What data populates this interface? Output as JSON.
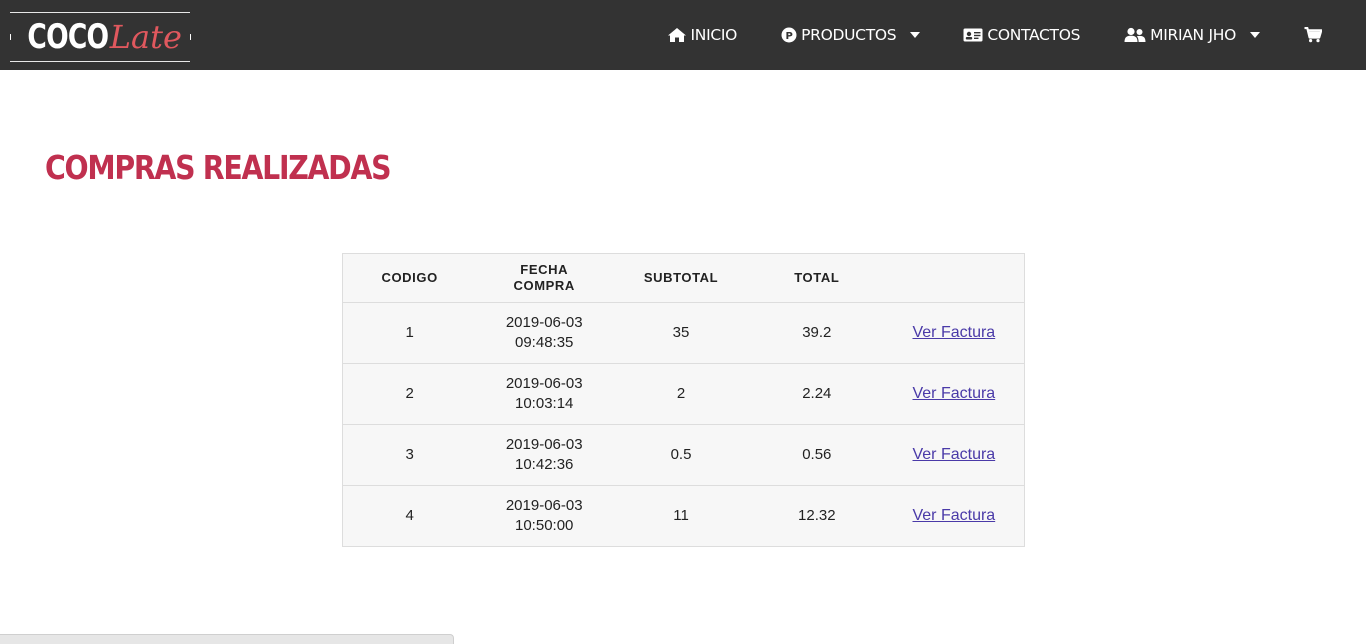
{
  "brand": {
    "part1": "COCO",
    "part2": "Late"
  },
  "nav": {
    "items": [
      {
        "label": "INICIO",
        "icon": "home-icon",
        "dropdown": false
      },
      {
        "label": "PRODUCTOS",
        "icon": "product-circle-icon",
        "dropdown": true
      },
      {
        "label": "CONTACTOS",
        "icon": "id-card-icon",
        "dropdown": false
      },
      {
        "label": "MIRIAN JHO",
        "icon": "users-icon",
        "dropdown": true
      }
    ],
    "cart_icon": "cart-icon"
  },
  "page": {
    "title": "COMPRAS REALIZADAS"
  },
  "table": {
    "headers": {
      "codigo": "CODIGO",
      "fecha_line1": "FECHA",
      "fecha_line2": "COMPRA",
      "subtotal": "SUBTOTAL",
      "total": "TOTAL"
    },
    "rows": [
      {
        "codigo": "1",
        "date": "2019-06-03",
        "time": "09:48:35",
        "subtotal": "35",
        "total": "39.2",
        "action": "Ver Factura"
      },
      {
        "codigo": "2",
        "date": "2019-06-03",
        "time": "10:03:14",
        "subtotal": "2",
        "total": "2.24",
        "action": "Ver Factura"
      },
      {
        "codigo": "3",
        "date": "2019-06-03",
        "time": "10:42:36",
        "subtotal": "0.5",
        "total": "0.56",
        "action": "Ver Factura"
      },
      {
        "codigo": "4",
        "date": "2019-06-03",
        "time": "10:50:00",
        "subtotal": "11",
        "total": "12.32",
        "action": "Ver Factura"
      }
    ]
  },
  "colors": {
    "navbar_bg": "#333333",
    "title": "#c0304f",
    "brand_accent": "#e0585e",
    "link": "#4a3aa8"
  }
}
